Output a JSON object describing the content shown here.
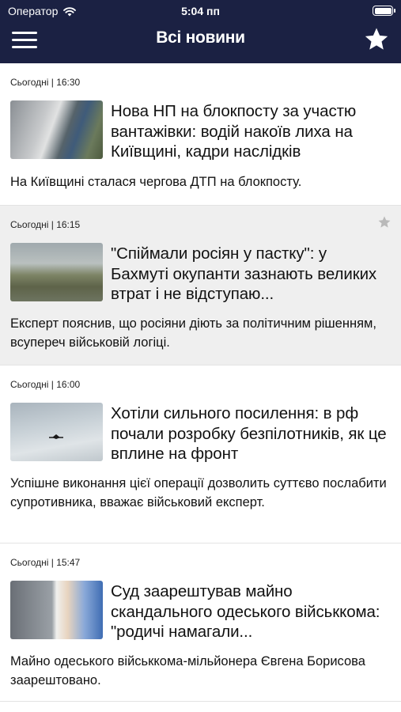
{
  "status_bar": {
    "carrier": "Оператор",
    "time": "5:04 пп"
  },
  "nav": {
    "title": "Всі новини"
  },
  "colors": {
    "nav_bg": "#1b2143",
    "alt_card_bg": "#efefef"
  },
  "articles": [
    {
      "timestamp": "Сьогодні | 16:30",
      "headline": "Нова НП на блокпосту за участю вантажівки: водій накоїв лиха на Київщині, кадри наслідків",
      "summary": "На Київщині сталася чергова ДТП на блокпосту."
    },
    {
      "timestamp": "Сьогодні | 16:15",
      "headline": "\"Спіймали росіян у пастку\": у Бахмуті окупанти зазнають великих втрат і не відступаю...",
      "summary": "Експерт пояснив, що росіяни діють за політичним рішенням, всупереч військовій логіці."
    },
    {
      "timestamp": "Сьогодні | 16:00",
      "headline": "Хотіли сильного посилення: в рф почали розробку безпілотників, як це вплине на фронт",
      "summary": "Успішне виконання цієї операції дозволить суттєво послабити супротивника, вважає військовий експерт."
    },
    {
      "timestamp": "Сьогодні | 15:47",
      "headline": "Суд заарештував майно скандального одеського військкома: \"родичі намагали...",
      "summary": "Майно одеського військкома-мільйонера Євгена Борисова заарештовано."
    }
  ]
}
